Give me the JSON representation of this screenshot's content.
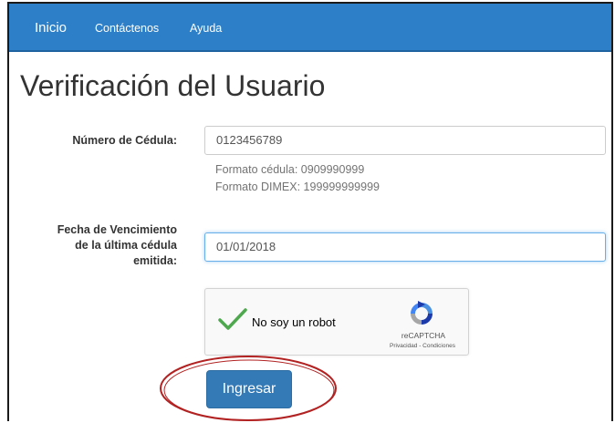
{
  "nav": {
    "brand": "Inicio",
    "contact": "Contáctenos",
    "help": "Ayuda"
  },
  "page": {
    "title": "Verificación del Usuario"
  },
  "form": {
    "cedula": {
      "label": "Número de Cédula:",
      "value": "0123456789",
      "help_1": "Formato cédula: 0909990999",
      "help_2": "Formato DIMEX: 199999999999"
    },
    "fecha": {
      "label": "Fecha de Vencimiento\nde la última cédula\nemitida:",
      "value": "01/01/2018"
    },
    "recaptcha": {
      "label": "No soy un robot",
      "brand": "reCAPTCHA",
      "links": "Privacidad - Condiciones"
    },
    "submit_label": "Ingresar"
  },
  "colors": {
    "navbar": "#2d7fc7",
    "button": "#337ab7",
    "check": "#4ea84e",
    "annotation": "#b22222"
  }
}
